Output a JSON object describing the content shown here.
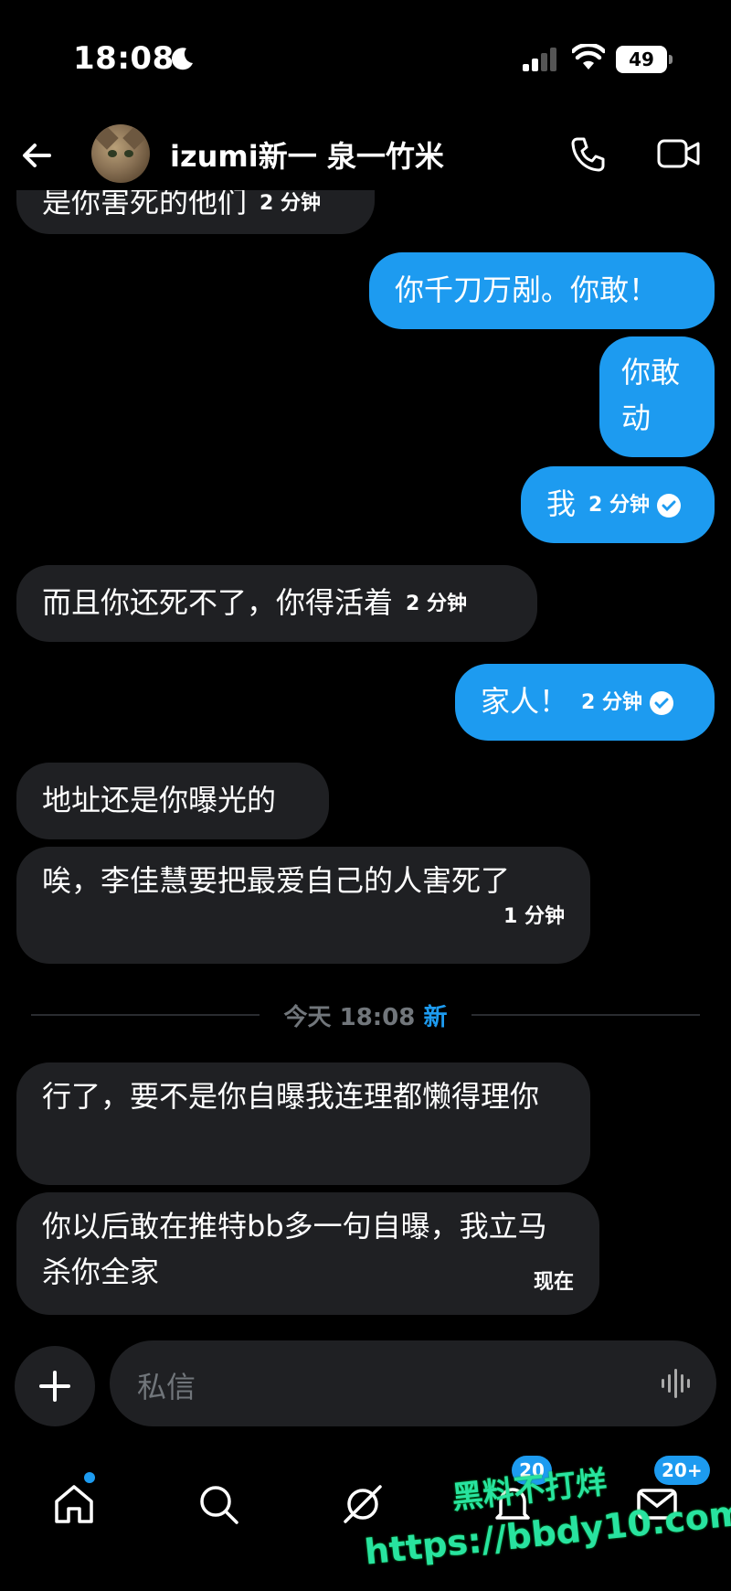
{
  "status_bar": {
    "time": "18:08",
    "battery": "49"
  },
  "header": {
    "name": "izumi新一 泉一竹米"
  },
  "messages": [
    {
      "side": "in",
      "text": "是你害死的他们",
      "meta": "2 分钟"
    },
    {
      "side": "out",
      "text": "你千刀万剐。你敢！"
    },
    {
      "side": "out",
      "text": "你敢动"
    },
    {
      "side": "out",
      "text": "我",
      "meta": "2 分钟"
    },
    {
      "side": "in",
      "text": "而且你还死不了，你得活着",
      "meta": "2 分钟"
    },
    {
      "side": "out",
      "text": "家人！",
      "meta": "2 分钟"
    },
    {
      "side": "in",
      "text": "地址还是你曝光的"
    },
    {
      "side": "in",
      "text": "唉，李佳慧要把最爱自己的人害死了",
      "meta": "1 分钟"
    },
    {
      "side": "in",
      "text": "行了，要不是你自曝我连理都懒得理你"
    },
    {
      "side": "in",
      "text": "你以后敢在推特bb多一句自曝，我立马杀你全家",
      "meta": "现在"
    }
  ],
  "divider": {
    "text": "今天 18:08",
    "new_label": "新"
  },
  "composer": {
    "placeholder": "私信"
  },
  "nav": {
    "badge_notifications": "20",
    "badge_messages": "20+"
  },
  "watermark": {
    "line1": "黑料不打烊",
    "line2": "https://bbdy10.com"
  },
  "colors": {
    "accent": "#1d9bf0",
    "bubble_in": "#1f2023",
    "background": "#000000",
    "watermark": "#28e39f"
  }
}
